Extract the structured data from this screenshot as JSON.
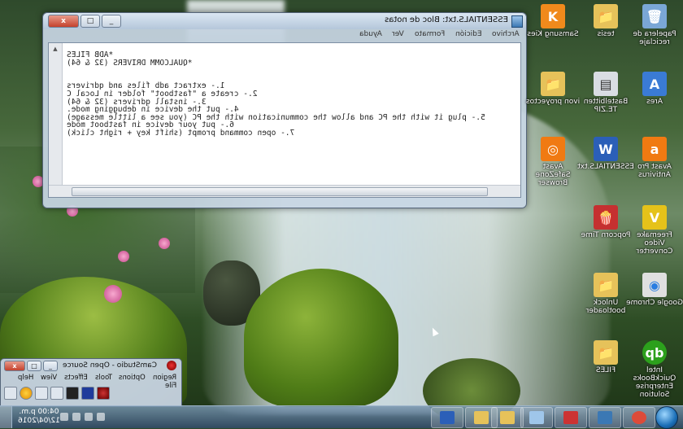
{
  "notepad": {
    "title": "ESSENTIALS.txt: Bloc de notas",
    "controls": {
      "close": "x",
      "maximize": "□",
      "minimize": "_"
    },
    "menu": [
      "Archivo",
      "Edición",
      "Formato",
      "Ver",
      "Ayuda"
    ],
    "lines": [
      "*ADB FILES",
      "*QUALCOMM DRIVERS (32 & 64)",
      "",
      "",
      "1.- extract adb files and qdrivers",
      "2.- create a \"fastboot\" folder in Local C",
      "3.- install qdrivers (32 & 64)",
      "4.- put the device in debugging mode.",
      "5.- plug it with the PC and allow the communication with the PC (you see a little message)",
      "6.- put your device in fastboot mode",
      "7.- open command prompt (shift key + right click)"
    ]
  },
  "camstudio": {
    "title": "CamStudio - Open Source",
    "menu": [
      "File",
      "Region",
      "Options",
      "Tools",
      "Effects",
      "View",
      "Help"
    ]
  },
  "desktop_icons": [
    {
      "label": "Papelera de reciclaje",
      "icon": "recycle-bin-icon",
      "color": "#7aa7d6",
      "glyph": "🗑"
    },
    {
      "label": "tesis",
      "icon": "folder-icon",
      "color": "#e6c25a",
      "glyph": "📁"
    },
    {
      "label": "Samsung Kies",
      "icon": "kies-icon",
      "color": "#f08a1c",
      "glyph": "K"
    },
    {
      "label": "Ares",
      "icon": "ares-icon",
      "color": "#3a7bd5",
      "glyph": "A"
    },
    {
      "label": "Bastelbitten TE.ZIP",
      "icon": "zip-icon",
      "color": "#d9dde3",
      "glyph": "▤"
    },
    {
      "label": "ivon proyectos",
      "icon": "folder-icon",
      "color": "#e6c25a",
      "glyph": "📁"
    },
    {
      "label": "Avast Pro Antivirus",
      "icon": "avast-icon",
      "color": "#f07a12",
      "glyph": "a"
    },
    {
      "label": "ESSENTIALS.txt",
      "icon": "word-doc-icon",
      "color": "#2b5fb8",
      "glyph": "W"
    },
    {
      "label": "Avast SafeZone Browser",
      "icon": "safezone-icon",
      "color": "#f07a12",
      "glyph": "◎"
    },
    {
      "label": "Freemake Video Converter",
      "icon": "freemake-icon",
      "color": "#e5c21a",
      "glyph": "V"
    },
    {
      "label": "Popcorn Time",
      "icon": "popcorn-icon",
      "color": "#c53030",
      "glyph": "🍿"
    },
    {
      "label": "Google Chrome",
      "icon": "chrome-icon",
      "color": "#e0e0e0",
      "glyph": "◉"
    },
    {
      "label": "Unlock bootloader",
      "icon": "folder-icon",
      "color": "#e6c25a",
      "glyph": "📁"
    },
    {
      "label": "Intel QuickBooks Enterprise Solution",
      "icon": "quickbooks-icon",
      "color": "#2ca01c",
      "glyph": "qb"
    },
    {
      "label": "FILES",
      "icon": "folder-icon",
      "color": "#e6c25a",
      "glyph": "📁"
    }
  ],
  "taskbar": {
    "time": "04:00 p.m.",
    "date": "12/04/2016",
    "buttons": [
      {
        "name": "explorer",
        "color": "#e6c25a"
      },
      {
        "name": "chrome",
        "color": "#dd4b39"
      },
      {
        "name": "media",
        "color": "#3b78b4"
      },
      {
        "name": "camstudio",
        "color": "#c33"
      },
      {
        "name": "notepad",
        "color": "#9fc6ea"
      },
      {
        "name": "word",
        "color": "#2b5fb8"
      },
      {
        "name": "folder",
        "color": "#e6c25a"
      }
    ]
  }
}
